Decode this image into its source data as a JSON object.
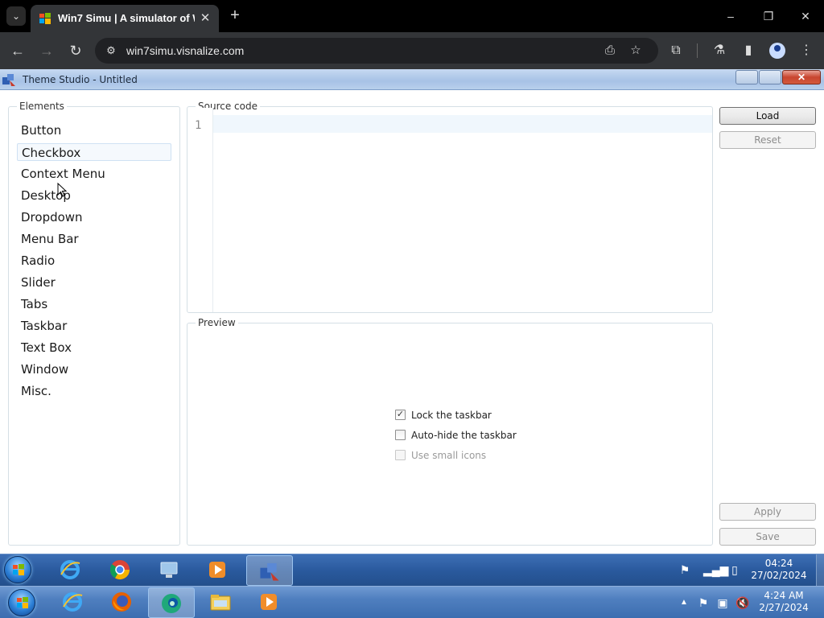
{
  "browser": {
    "tab_title": "Win7 Simu | A simulator of Windows 7",
    "url": "win7simu.visnalize.com",
    "icons": {
      "tab_search": "chevron-down-icon",
      "close_tab": "close-icon",
      "new_tab": "plus-icon",
      "back": "arrow-left-icon",
      "forward": "arrow-right-icon",
      "reload": "reload-icon",
      "site_info": "tune-icon",
      "install": "install-app-icon",
      "bookmark": "star-icon",
      "extensions": "puzzle-icon",
      "labs": "flask-icon",
      "side_panel": "side-panel-icon",
      "profile": "profile-icon",
      "menu": "kebab-menu-icon"
    },
    "window_controls": {
      "minimize": "–",
      "restore": "❐",
      "close": "✕"
    }
  },
  "app": {
    "title": "Theme Studio - Untitled",
    "elements_label": "Elements",
    "elements": [
      "Button",
      "Checkbox",
      "Context Menu",
      "Desktop",
      "Dropdown",
      "Menu Bar",
      "Radio",
      "Slider",
      "Tabs",
      "Taskbar",
      "Text Box",
      "Window",
      "Misc."
    ],
    "selected_element": "Checkbox",
    "source_code_label": "Source code",
    "source_code_line": "1",
    "preview_label": "Preview",
    "preview_checkboxes": [
      {
        "label": "Lock the taskbar",
        "checked": true,
        "disabled": false
      },
      {
        "label": "Auto-hide the taskbar",
        "checked": false,
        "disabled": false
      },
      {
        "label": "Use small icons",
        "checked": false,
        "disabled": true
      }
    ],
    "buttons": {
      "load": "Load",
      "reset": "Reset",
      "apply": "Apply",
      "save": "Save"
    }
  },
  "sim_taskbar": {
    "time": "04:24",
    "date": "27/02/2024"
  },
  "host_taskbar": {
    "time": "4:24 AM",
    "date": "2/27/2024"
  },
  "colors": {
    "accent": "#2a5a9e",
    "selection_bg": "#f5f9fd"
  }
}
